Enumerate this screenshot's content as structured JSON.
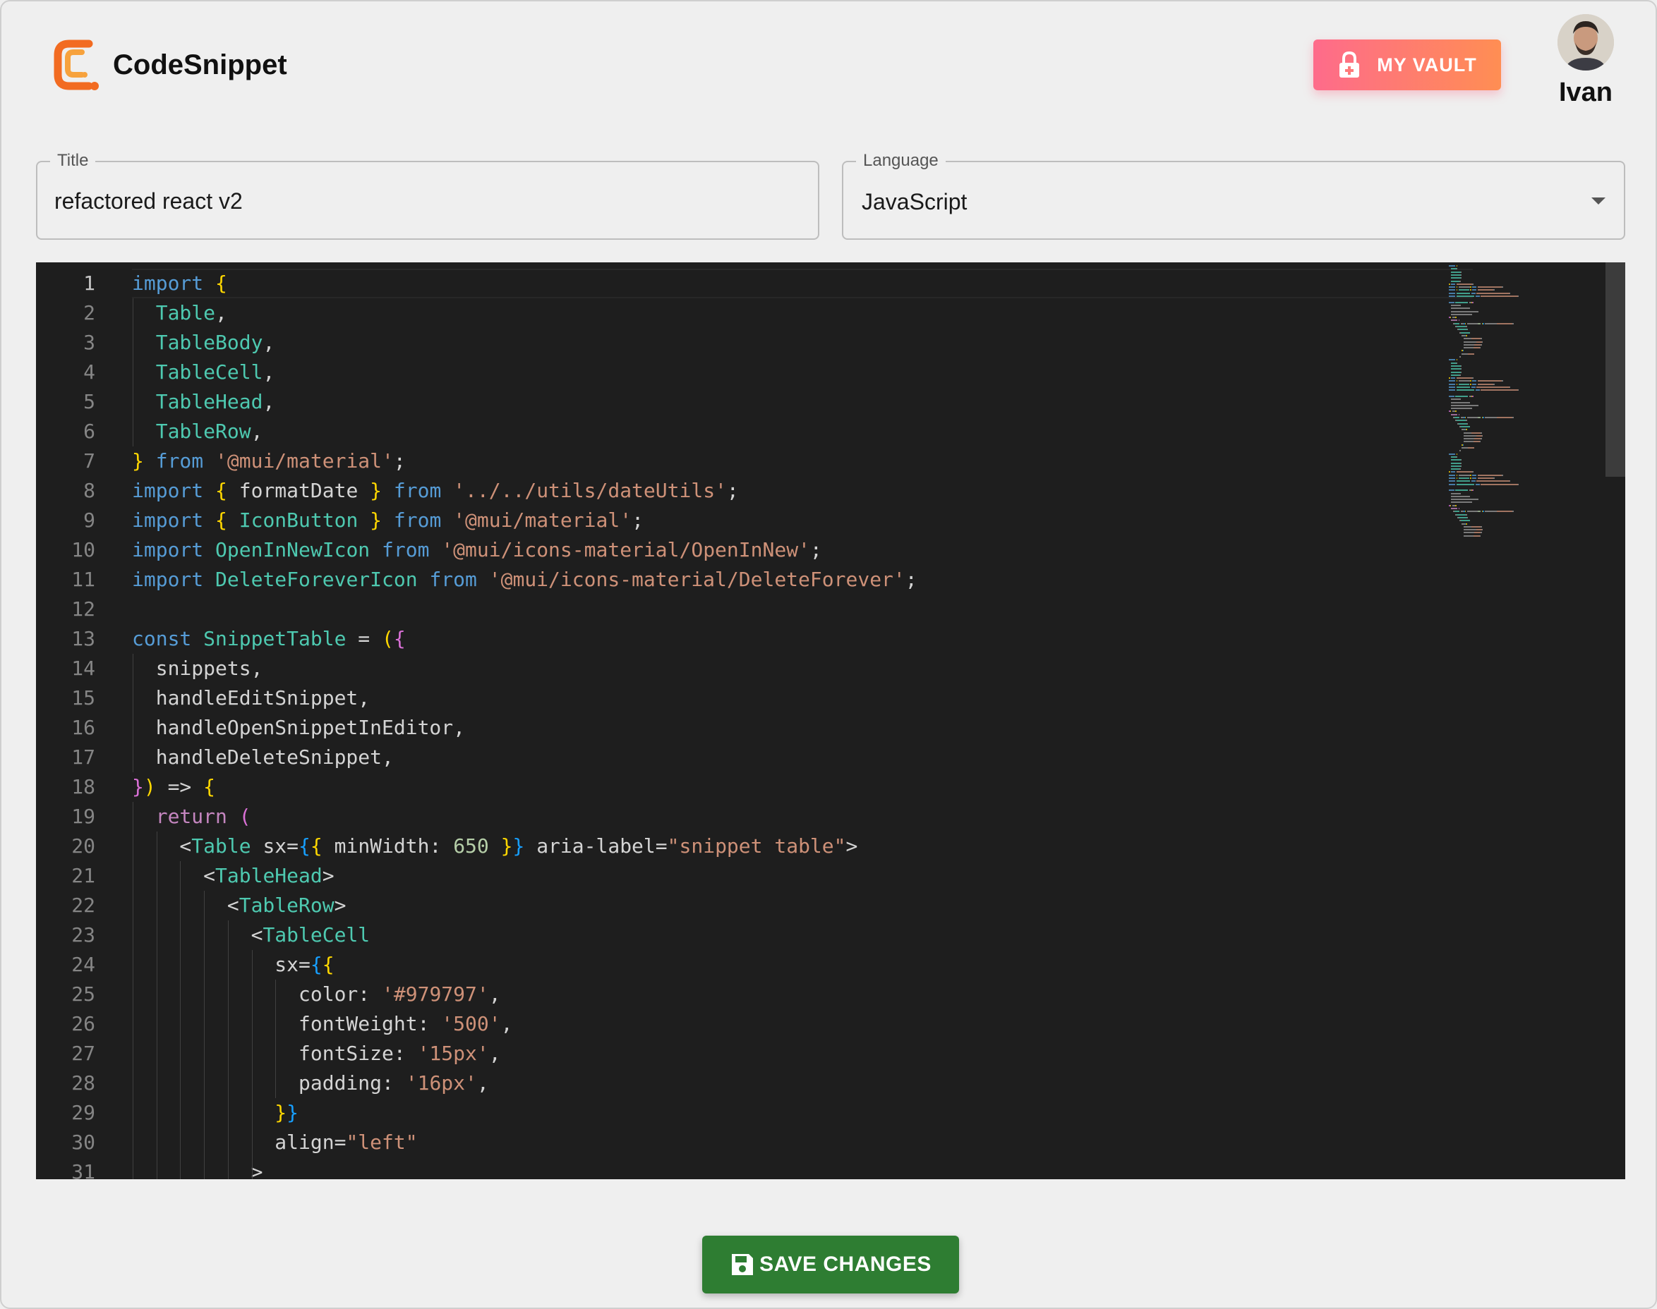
{
  "app": {
    "name": "CodeSnippet",
    "logo_icon": "codesnippet-logo-icon",
    "accent": "#f26b21"
  },
  "header": {
    "vault_button_label": "MY VAULT",
    "vault_icon": "lock-icon",
    "vault_gradient": [
      "#fe6b8b",
      "#ff8e53"
    ],
    "user_name": "Ivan"
  },
  "form": {
    "title_label": "Title",
    "title_value": "refactored react v2",
    "language_label": "Language",
    "language_value": "JavaScript"
  },
  "editor": {
    "line_numbers": [
      "1",
      "2",
      "3",
      "4",
      "5",
      "6",
      "7",
      "8",
      "9",
      "10",
      "11",
      "12",
      "13",
      "14",
      "15",
      "16",
      "17",
      "18",
      "19",
      "20",
      "21",
      "22",
      "23",
      "24",
      "25",
      "26",
      "27",
      "28",
      "29",
      "30",
      "31"
    ],
    "lines": [
      [
        [
          "kw",
          "import"
        ],
        [
          "t",
          " "
        ],
        [
          "br1",
          "{"
        ]
      ],
      [
        [
          "t",
          "  "
        ],
        [
          "cls",
          "Table"
        ],
        [
          "t",
          ","
        ]
      ],
      [
        [
          "t",
          "  "
        ],
        [
          "cls",
          "TableBody"
        ],
        [
          "t",
          ","
        ]
      ],
      [
        [
          "t",
          "  "
        ],
        [
          "cls",
          "TableCell"
        ],
        [
          "t",
          ","
        ]
      ],
      [
        [
          "t",
          "  "
        ],
        [
          "cls",
          "TableHead"
        ],
        [
          "t",
          ","
        ]
      ],
      [
        [
          "t",
          "  "
        ],
        [
          "cls",
          "TableRow"
        ],
        [
          "t",
          ","
        ]
      ],
      [
        [
          "br1",
          "}"
        ],
        [
          "t",
          " "
        ],
        [
          "kw",
          "from"
        ],
        [
          "t",
          " "
        ],
        [
          "str",
          "'@mui/material'"
        ],
        [
          "t",
          ";"
        ]
      ],
      [
        [
          "kw",
          "import"
        ],
        [
          "t",
          " "
        ],
        [
          "br1",
          "{"
        ],
        [
          "t",
          " formatDate "
        ],
        [
          "br1",
          "}"
        ],
        [
          "t",
          " "
        ],
        [
          "kw",
          "from"
        ],
        [
          "t",
          " "
        ],
        [
          "str",
          "'../../utils/dateUtils'"
        ],
        [
          "t",
          ";"
        ]
      ],
      [
        [
          "kw",
          "import"
        ],
        [
          "t",
          " "
        ],
        [
          "br1",
          "{"
        ],
        [
          "t",
          " "
        ],
        [
          "cls",
          "IconButton"
        ],
        [
          "t",
          " "
        ],
        [
          "br1",
          "}"
        ],
        [
          "t",
          " "
        ],
        [
          "kw",
          "from"
        ],
        [
          "t",
          " "
        ],
        [
          "str",
          "'@mui/material'"
        ],
        [
          "t",
          ";"
        ]
      ],
      [
        [
          "kw",
          "import"
        ],
        [
          "t",
          " "
        ],
        [
          "cls",
          "OpenInNewIcon"
        ],
        [
          "t",
          " "
        ],
        [
          "kw",
          "from"
        ],
        [
          "t",
          " "
        ],
        [
          "str",
          "'@mui/icons-material/OpenInNew'"
        ],
        [
          "t",
          ";"
        ]
      ],
      [
        [
          "kw",
          "import"
        ],
        [
          "t",
          " "
        ],
        [
          "cls",
          "DeleteForeverIcon"
        ],
        [
          "t",
          " "
        ],
        [
          "kw",
          "from"
        ],
        [
          "t",
          " "
        ],
        [
          "str",
          "'@mui/icons-material/DeleteForever'"
        ],
        [
          "t",
          ";"
        ]
      ],
      [
        [
          "t",
          ""
        ]
      ],
      [
        [
          "kw",
          "const"
        ],
        [
          "t",
          " "
        ],
        [
          "cls",
          "SnippetTable"
        ],
        [
          "t",
          " = "
        ],
        [
          "br1",
          "("
        ],
        [
          "br2",
          "{"
        ]
      ],
      [
        [
          "t",
          "  snippets,"
        ]
      ],
      [
        [
          "t",
          "  handleEditSnippet,"
        ]
      ],
      [
        [
          "t",
          "  handleOpenSnippetInEditor,"
        ]
      ],
      [
        [
          "t",
          "  handleDeleteSnippet,"
        ]
      ],
      [
        [
          "br2",
          "}"
        ],
        [
          "br1",
          ")"
        ],
        [
          "t",
          " => "
        ],
        [
          "br1",
          "{"
        ]
      ],
      [
        [
          "t",
          "  "
        ],
        [
          "ctl",
          "return"
        ],
        [
          "t",
          " "
        ],
        [
          "br2",
          "("
        ]
      ],
      [
        [
          "t",
          "    <"
        ],
        [
          "cls",
          "Table"
        ],
        [
          "t",
          " sx="
        ],
        [
          "br3",
          "{"
        ],
        [
          "br1",
          "{"
        ],
        [
          "t",
          " minWidth: "
        ],
        [
          "num",
          "650"
        ],
        [
          "t",
          " "
        ],
        [
          "br1",
          "}"
        ],
        [
          "br3",
          "}"
        ],
        [
          "t",
          " aria-label="
        ],
        [
          "str",
          "\"snippet table\""
        ],
        [
          "t",
          ">"
        ]
      ],
      [
        [
          "t",
          "      <"
        ],
        [
          "cls",
          "TableHead"
        ],
        [
          "t",
          ">"
        ]
      ],
      [
        [
          "t",
          "        <"
        ],
        [
          "cls",
          "TableRow"
        ],
        [
          "t",
          ">"
        ]
      ],
      [
        [
          "t",
          "          <"
        ],
        [
          "cls",
          "TableCell"
        ]
      ],
      [
        [
          "t",
          "            sx="
        ],
        [
          "br3",
          "{"
        ],
        [
          "br1",
          "{"
        ]
      ],
      [
        [
          "t",
          "              color: "
        ],
        [
          "str",
          "'#979797'"
        ],
        [
          "t",
          ","
        ]
      ],
      [
        [
          "t",
          "              fontWeight: "
        ],
        [
          "str",
          "'500'"
        ],
        [
          "t",
          ","
        ]
      ],
      [
        [
          "t",
          "              fontSize: "
        ],
        [
          "str",
          "'15px'"
        ],
        [
          "t",
          ","
        ]
      ],
      [
        [
          "t",
          "              padding: "
        ],
        [
          "str",
          "'16px'"
        ],
        [
          "t",
          ","
        ]
      ],
      [
        [
          "t",
          "            "
        ],
        [
          "br1",
          "}"
        ],
        [
          "br3",
          "}"
        ]
      ],
      [
        [
          "t",
          "            align="
        ],
        [
          "str",
          "\"left\""
        ]
      ],
      [
        [
          "t",
          "          >"
        ]
      ]
    ],
    "theme_background": "#1e1e1e"
  },
  "footer": {
    "save_label": "SAVE CHANGES",
    "save_icon": "save-icon",
    "save_color": "#2e7d32"
  }
}
